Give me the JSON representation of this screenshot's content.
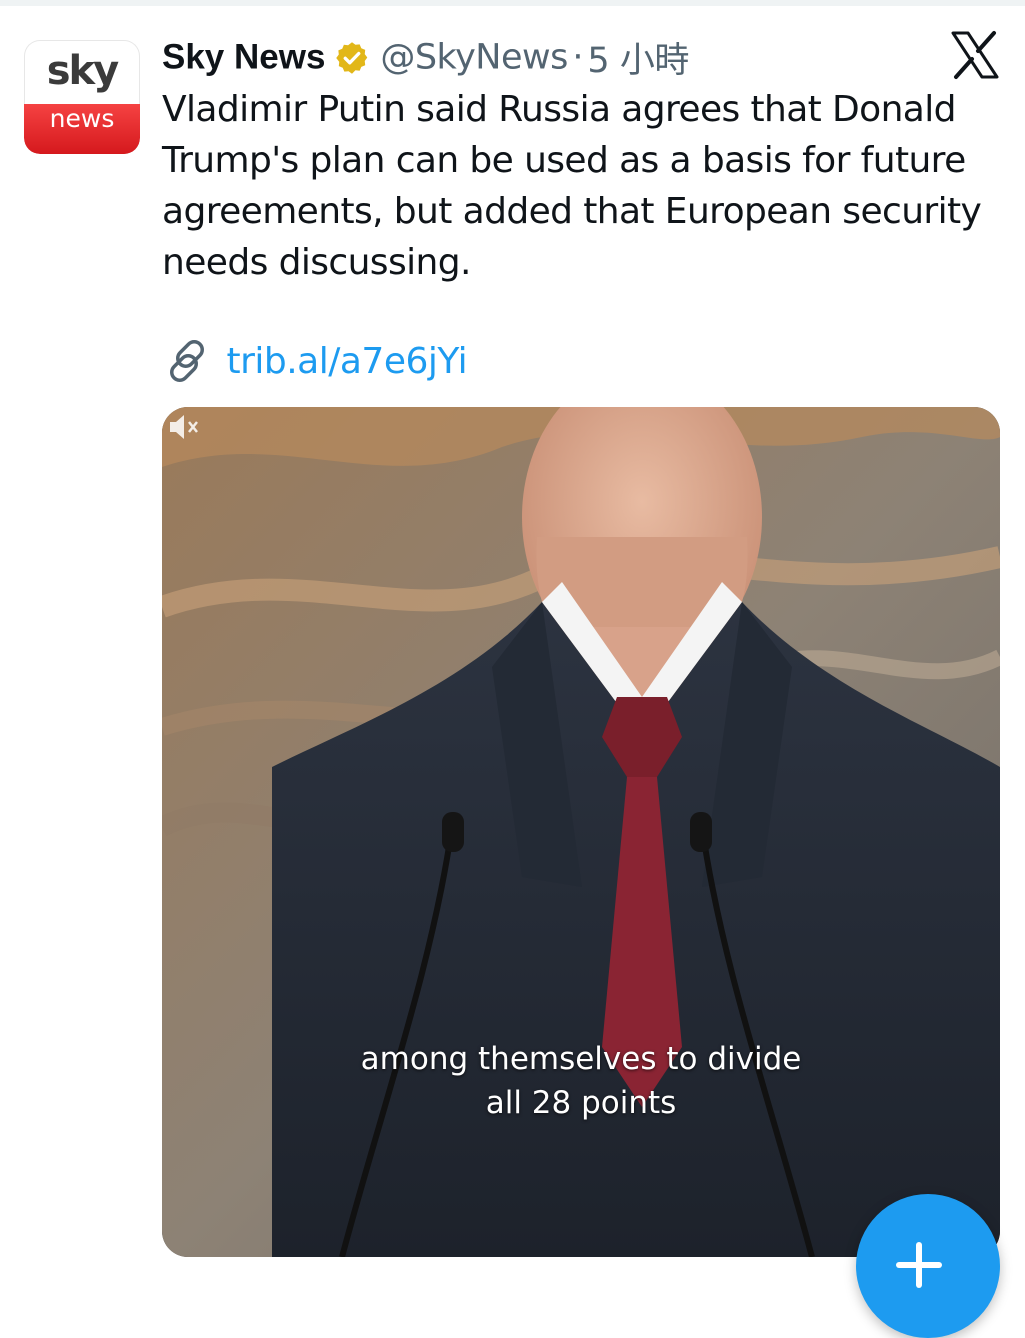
{
  "account": {
    "name": "Sky News",
    "handle": "@SkyNews",
    "separator": "·",
    "time": "5 小時",
    "verified_icon": "verified-badge-icon",
    "avatar_top": "sky",
    "avatar_bottom": "news"
  },
  "tweet": {
    "text": "Vladimir Putin said Russia agrees that Donald Trump's plan can be used as a basis for future agreements, but added that European security needs discussing.",
    "link": "trib.al/a7e6jYi",
    "link_icon": "link-icon"
  },
  "media": {
    "caption_lines": [
      "among themselves to divide",
      "all 28 points"
    ],
    "mute_icon": "speaker-muted-icon"
  },
  "fab": {
    "icon": "plus-icon"
  },
  "colors": {
    "link": "#1d9bf0",
    "fab": "#1d9bf0",
    "secondary_text": "#536471",
    "verified_badge": "#e2b719",
    "sky_red": "#e5262a"
  }
}
